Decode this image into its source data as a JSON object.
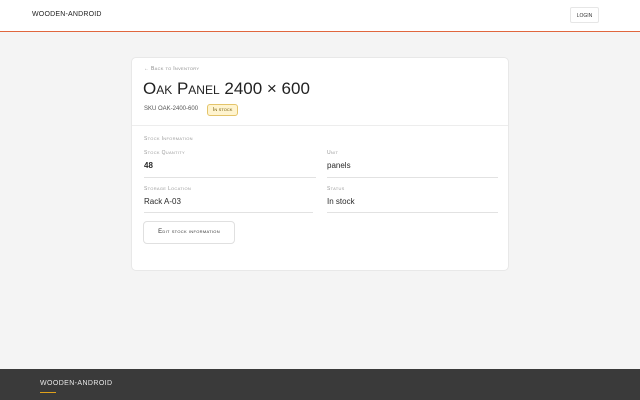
{
  "header": {
    "brand": "WOODEN-ANDROID",
    "login_label": "LOGIN"
  },
  "card": {
    "back_label": "← Back to Inventory",
    "title": "Oak Panel 2400 × 600",
    "sku": "SKU OAK-2400-600",
    "status_badge": "In stock",
    "section_title": "Stock Information",
    "fields": {
      "stock_quantity": {
        "label": "Stock Quantity",
        "value": "48"
      },
      "unit": {
        "label": "Unit",
        "value": "panels"
      },
      "storage_location": {
        "label": "Storage Location",
        "value": "Rack A-03"
      },
      "status": {
        "label": "Status",
        "value": "In stock"
      }
    },
    "edit_label": "Edit stock information"
  },
  "footer": {
    "brand": "WOODEN-ANDROID"
  },
  "colors": {
    "accent": "#e0663d",
    "badge_bg": "#fff4cf",
    "footer_bg": "#3a3a3a",
    "footer_accent": "#e0a11b"
  }
}
